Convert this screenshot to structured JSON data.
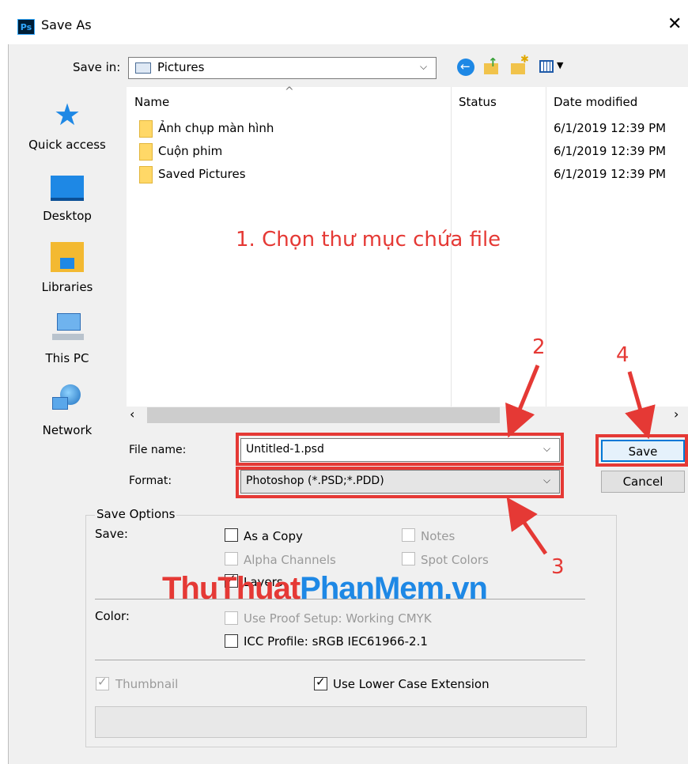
{
  "window": {
    "title": "Save As",
    "app_icon": "Ps",
    "close_glyph": "✕"
  },
  "save_in": {
    "label": "Save in:",
    "value": "Pictures",
    "toolbar_icons": [
      "back-icon",
      "up-folder-icon",
      "new-folder-icon",
      "view-menu-icon"
    ]
  },
  "places": [
    {
      "label": "Quick access",
      "icon": "star-icon"
    },
    {
      "label": "Desktop",
      "icon": "desktop-icon"
    },
    {
      "label": "Libraries",
      "icon": "libraries-icon"
    },
    {
      "label": "This PC",
      "icon": "computer-icon"
    },
    {
      "label": "Network",
      "icon": "network-icon"
    }
  ],
  "list": {
    "columns": [
      "Name",
      "Status",
      "Date modified"
    ],
    "rows": [
      {
        "name": "Ảnh chụp màn hình",
        "status": "",
        "date": "6/1/2019 12:39 PM"
      },
      {
        "name": "Cuộn phim",
        "status": "",
        "date": "6/1/2019 12:39 PM"
      },
      {
        "name": "Saved Pictures",
        "status": "",
        "date": "6/1/2019 12:39 PM"
      }
    ]
  },
  "file_name": {
    "label": "File name:",
    "value": "Untitled-1.psd"
  },
  "format": {
    "label": "Format:",
    "value": "Photoshop (*.PSD;*.PDD)"
  },
  "buttons": {
    "save": "Save",
    "cancel": "Cancel"
  },
  "save_options": {
    "title": "Save Options",
    "save_label": "Save:",
    "as_a_copy": {
      "label": "As a Copy",
      "checked": false
    },
    "notes": {
      "label": "Notes",
      "checked": false
    },
    "alpha_channels": {
      "label": "Alpha Channels",
      "checked": false
    },
    "spot_colors": {
      "label": "Spot Colors",
      "checked": false
    },
    "layers": {
      "label": "Layers",
      "checked": true
    },
    "color_label": "Color:",
    "use_proof_setup": {
      "label": "Use Proof Setup:  Working CMYK",
      "checked": false
    },
    "icc_profile": {
      "label": "ICC Profile:  sRGB IEC61966-2.1",
      "checked": false
    },
    "thumbnail": {
      "label": "Thumbnail",
      "checked": true
    },
    "lower_case_ext": {
      "label": "Use Lower Case Extension",
      "checked": true
    }
  },
  "annotations": {
    "step1": "1. Chọn thư mục chứa file",
    "step2": "2",
    "step3": "3",
    "step4": "4",
    "color": "#e53935"
  },
  "watermark": {
    "part1": "ThuThuat",
    "part2": "PhanMem",
    "part3": ".vn",
    "color1": "#e53935",
    "color2": "#1e88e5"
  }
}
